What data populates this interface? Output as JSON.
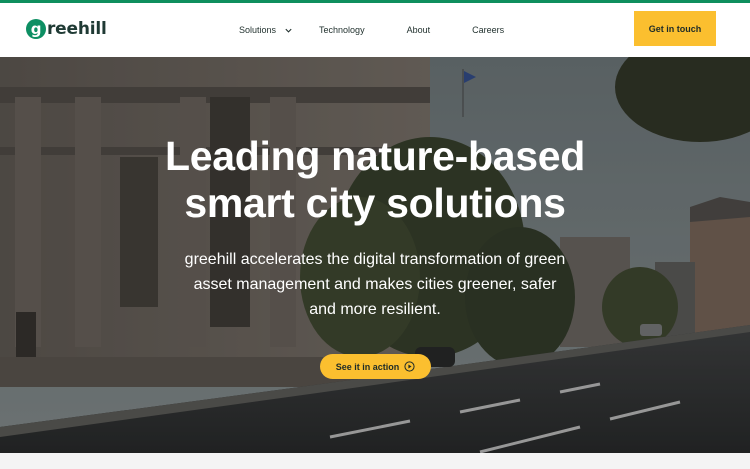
{
  "brand": {
    "logo_initial": "g",
    "logo_rest": "reehill",
    "accent": "#0e8f5e",
    "cta_color": "#fbbf2f"
  },
  "nav": {
    "items": [
      {
        "label": "Solutions",
        "has_dropdown": true,
        "icon": "chevron-down-icon"
      },
      {
        "label": "Technology"
      },
      {
        "label": "About"
      },
      {
        "label": "Careers"
      }
    ],
    "cta_label": "Get in touch"
  },
  "hero": {
    "title_line1": "Leading nature-based",
    "title_line2": "smart city solutions",
    "subtitle_line1": "greehill accelerates the digital transformation of green",
    "subtitle_line2": "asset management and makes cities greener, safer",
    "subtitle_line3": "and more resilient.",
    "button_label": "See it in action",
    "button_icon": "play-circle-icon"
  }
}
